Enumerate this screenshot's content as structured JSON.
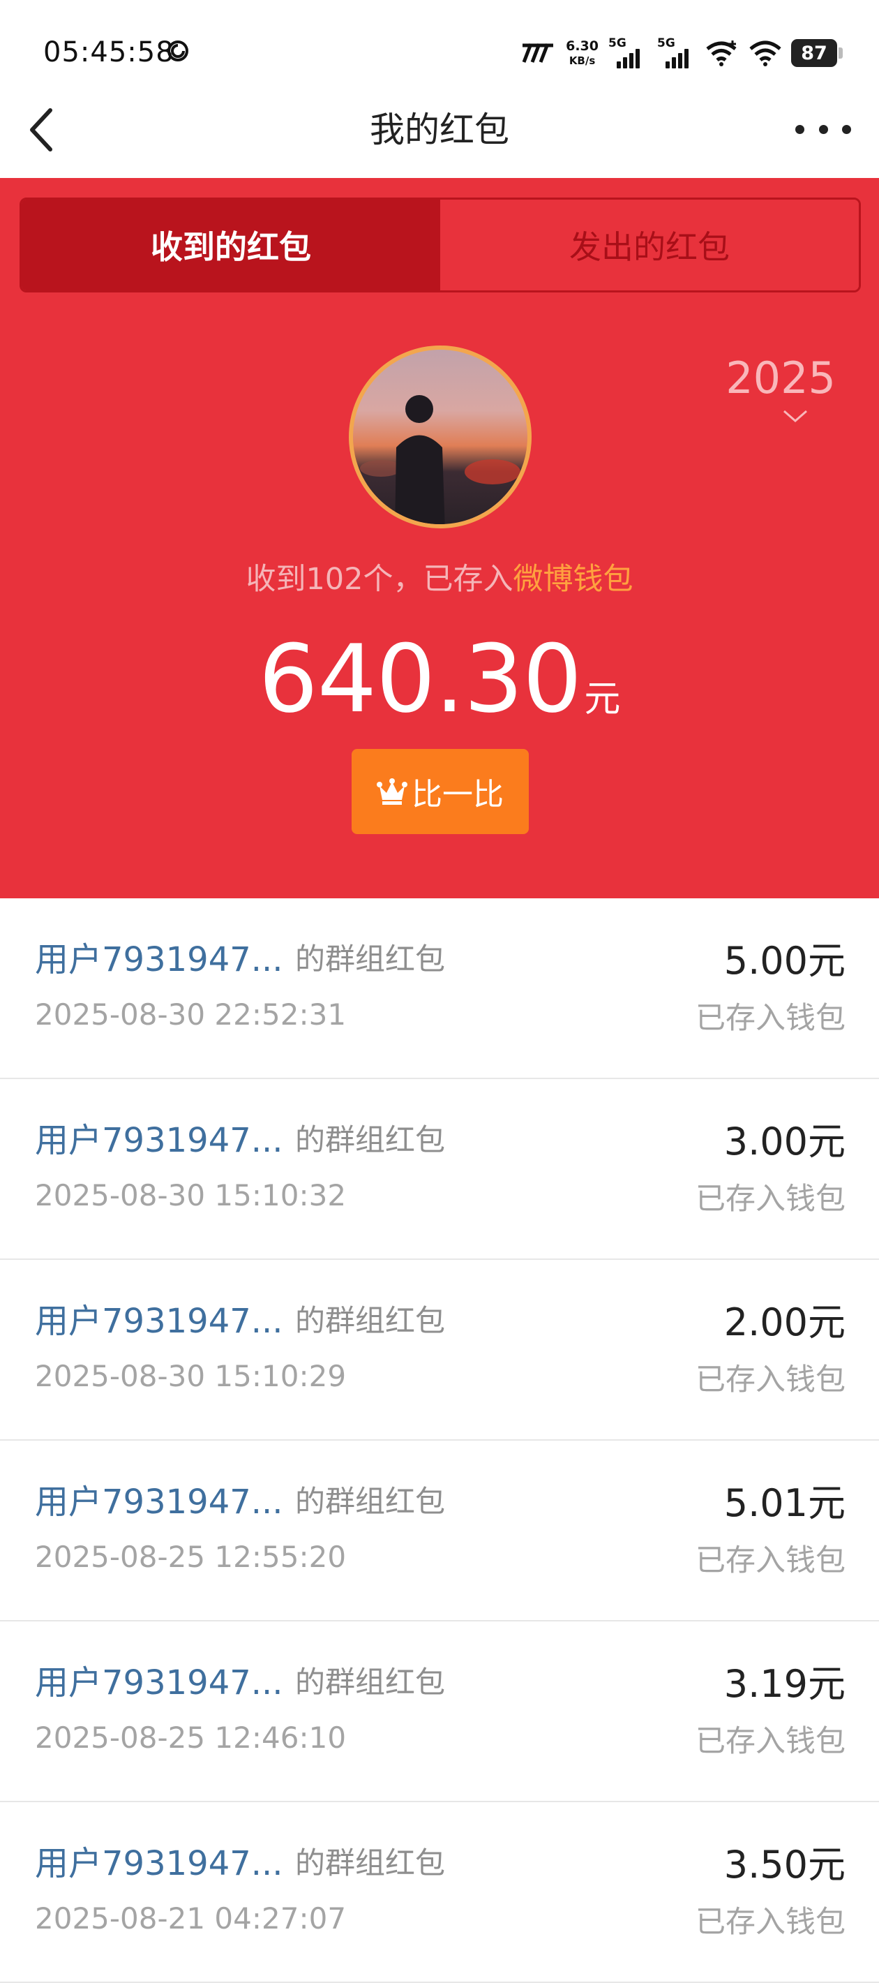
{
  "status_bar": {
    "time": "05:45:58",
    "speed_value": "6.30",
    "speed_unit": "KB/s",
    "signal_1_label": "5G",
    "signal_2_label": "5G",
    "battery": "87"
  },
  "nav": {
    "title": "我的红包"
  },
  "tabs": {
    "received": "收到的红包",
    "sent": "发出的红包"
  },
  "year": "2025",
  "summary": {
    "prefix": "收到102个，已存入",
    "wallet_link": "微博钱包"
  },
  "total": {
    "amount": "640.30",
    "unit": "元"
  },
  "compare_button": "比一比",
  "colors": {
    "header_red": "#e8323c",
    "tab_active": "#b9141d",
    "accent_orange": "#fb7c1d",
    "link_orange": "#ffa23f",
    "sender_blue": "#3f6f9e"
  },
  "packets": [
    {
      "sender": "用户7931947...",
      "kind": "的群组红包",
      "time": "2025-08-30 22:52:31",
      "amount": "5.00元",
      "status": "已存入钱包"
    },
    {
      "sender": "用户7931947...",
      "kind": "的群组红包",
      "time": "2025-08-30 15:10:32",
      "amount": "3.00元",
      "status": "已存入钱包"
    },
    {
      "sender": "用户7931947...",
      "kind": "的群组红包",
      "time": "2025-08-30 15:10:29",
      "amount": "2.00元",
      "status": "已存入钱包"
    },
    {
      "sender": "用户7931947...",
      "kind": "的群组红包",
      "time": "2025-08-25 12:55:20",
      "amount": "5.01元",
      "status": "已存入钱包"
    },
    {
      "sender": "用户7931947...",
      "kind": "的群组红包",
      "time": "2025-08-25 12:46:10",
      "amount": "3.19元",
      "status": "已存入钱包"
    },
    {
      "sender": "用户7931947...",
      "kind": "的群组红包",
      "time": "2025-08-21 04:27:07",
      "amount": "3.50元",
      "status": "已存入钱包"
    }
  ]
}
